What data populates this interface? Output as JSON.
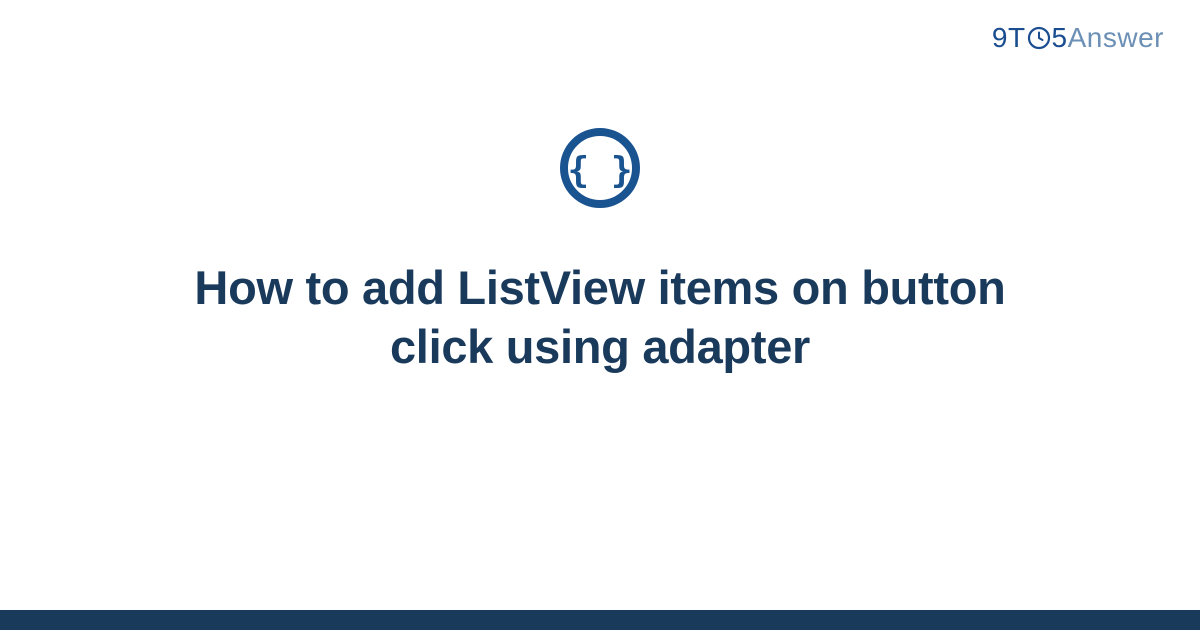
{
  "brand": {
    "nine": "9",
    "t": "T",
    "five": "5",
    "answer": "Answer"
  },
  "main": {
    "headline": "How to add ListView items on button click using adapter"
  },
  "colors": {
    "primary": "#1a3a5c",
    "brand_dark": "#1a4d8f",
    "brand_light": "#6b8fb5",
    "icon_ring": "#1a5490"
  }
}
